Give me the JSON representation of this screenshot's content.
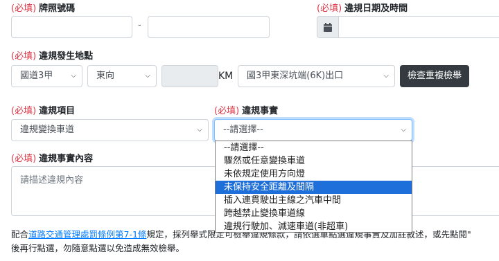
{
  "required_tag": "(必填)",
  "plate": {
    "label": "牌照號碼",
    "separator": "-"
  },
  "datetime": {
    "label": "違規日期及時間"
  },
  "location": {
    "label": "違規發生地點",
    "road": "國道3甲",
    "direction": "東向",
    "km_unit": "KM",
    "exit": "國3甲東深坑端(6K)出口",
    "check_button": "檢查重複檢舉"
  },
  "violation_item": {
    "label": "違規項目",
    "value": "違規變換車道"
  },
  "violation_fact": {
    "label": "違規事實",
    "value": "--請選擇--",
    "options": [
      "--請選擇--",
      "驟然或任意變換車道",
      "未依規定使用方向燈",
      "未保持安全距離及間隔",
      "插入連貫駛出主線之汽車中間",
      "跨越禁止變換車道線",
      "違規行駛加、減速車道(非超車)"
    ],
    "highlighted_index": 3
  },
  "violation_content": {
    "label": "違規事實內容",
    "placeholder": "請描述違規內容"
  },
  "footer": {
    "prefix": "配合",
    "link": "道路交通管理處罰條例第7-1條",
    "suffix": "規定，採列舉式限定可檢舉違規條款，請依選單點選違規事實及加註敘述，或先點閱\"",
    "line2": "後再行點選，勿隨意點選以免造成無效檢舉。"
  },
  "colors": {
    "required": "#dc3545",
    "highlight": "#1e6fd9",
    "link": "#007bff",
    "button": "#343a40"
  }
}
